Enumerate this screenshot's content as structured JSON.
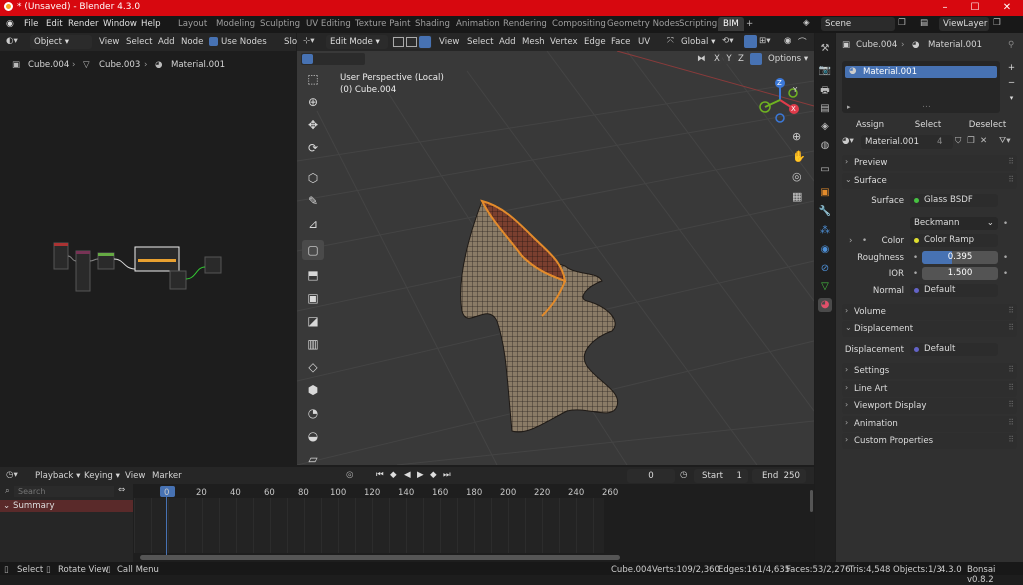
{
  "window": {
    "title": "* (Unsaved) - Blender 4.3.0",
    "minimize": "–",
    "maximize": "☐",
    "close": "✕"
  },
  "menu": [
    "File",
    "Edit",
    "Render",
    "Window",
    "Help"
  ],
  "workspaces": [
    "Layout",
    "Modeling",
    "Sculpting",
    "UV Editing",
    "Texture Paint",
    "Shading",
    "Animation",
    "Rendering",
    "Compositing",
    "Geometry Nodes",
    "Scripting",
    "BIM"
  ],
  "active_workspace": "BIM",
  "scene": {
    "label": "Scene",
    "view_layer": "ViewLayer"
  },
  "node_editor": {
    "mode": "Object",
    "menus": [
      "View",
      "Select",
      "Add",
      "Node"
    ],
    "use_nodes": "Use Nodes",
    "slot": "Slo",
    "breadcrumb": [
      "Cube.004",
      "Cube.003",
      "Material.001"
    ]
  },
  "viewport": {
    "mode": "Edit Mode",
    "menus": [
      "View",
      "Select",
      "Add",
      "Mesh",
      "Vertex",
      "Edge",
      "Face",
      "UV"
    ],
    "orientation": "Global",
    "options": "Options",
    "axes": [
      "X",
      "Y",
      "Z"
    ],
    "overlay_text": [
      "User Perspective (Local)",
      "(0) Cube.004"
    ],
    "gizmo": {
      "x": "X",
      "y": "Y",
      "z": "Z"
    }
  },
  "properties": {
    "breadcrumb": [
      "Cube.004",
      "Material.001"
    ],
    "slot_item": "Material.001",
    "assign": "Assign",
    "select": "Select",
    "deselect": "Deselect",
    "material_name": "Material.001",
    "users": "4",
    "sections": {
      "preview": "Preview",
      "surface": "Surface",
      "volume": "Volume",
      "displacement": "Displacement",
      "settings": "Settings",
      "line_art": "Line Art",
      "viewport_display": "Viewport Display",
      "animation": "Animation",
      "custom_properties": "Custom Properties"
    },
    "surface": {
      "label": "Surface",
      "value": "Glass BSDF",
      "distribution": "Beckmann",
      "color_label": "Color",
      "color_value": "Color Ramp",
      "roughness_label": "Roughness",
      "roughness": "0.395",
      "roughness_fraction": 0.395,
      "ior_label": "IOR",
      "ior": "1.500",
      "normal_label": "Normal",
      "normal": "Default"
    },
    "displacement": {
      "label": "Displacement",
      "value": "Default"
    },
    "colors": {
      "accent": "#4772b3",
      "green": "#46c241",
      "yellow": "#dede2f",
      "purple": "#6363c7"
    }
  },
  "timeline": {
    "menus": [
      "Playback",
      "Keying",
      "View",
      "Marker"
    ],
    "current_frame": "0",
    "start_label": "Start",
    "start": "1",
    "end_label": "End",
    "end": "250",
    "search_placeholder": "Search",
    "summary": "Summary",
    "ticks": [
      "0",
      "20",
      "40",
      "60",
      "80",
      "100",
      "120",
      "140",
      "160",
      "180",
      "200",
      "220",
      "240",
      "260"
    ]
  },
  "statusbar": {
    "hints": [
      "Select",
      "Rotate View",
      "Call Menu"
    ],
    "stats": [
      "Cube.004",
      "Verts:109/2,360",
      "Edges:161/4,635",
      "Faces:53/2,276",
      "Tris:4,548",
      "Objects:1/3",
      "4.3.0",
      "Bonsai v0.8.2"
    ]
  }
}
